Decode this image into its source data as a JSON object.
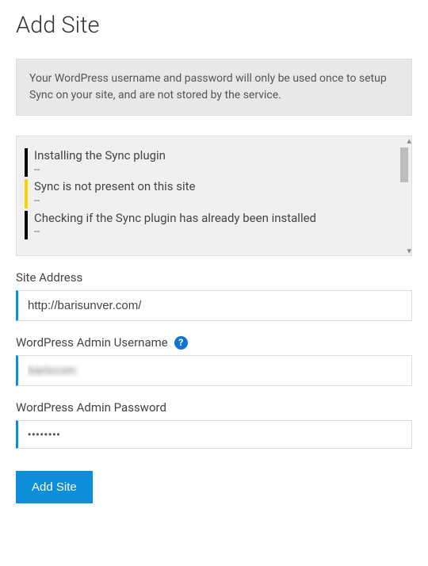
{
  "page": {
    "title": "Add Site"
  },
  "banner": {
    "text": "Your WordPress username and password will only be used once to setup Sync on your site, and are not stored by the service."
  },
  "log": {
    "entries": [
      {
        "text": "Installing the Sync plugin",
        "sep": "--",
        "level": "black"
      },
      {
        "text": "Sync is not present on this site",
        "sep": "--",
        "level": "yellow"
      },
      {
        "text": "Checking if the Sync plugin has already been installed",
        "sep": "--",
        "level": "black"
      }
    ]
  },
  "form": {
    "site_address": {
      "label": "Site Address",
      "value": "http://barisunver.com/"
    },
    "admin_username": {
      "label": "WordPress Admin Username",
      "value": "bariscom"
    },
    "admin_password": {
      "label": "WordPress Admin Password",
      "value": "••••••••"
    },
    "submit_label": "Add Site"
  },
  "icons": {
    "help_glyph": "?"
  }
}
